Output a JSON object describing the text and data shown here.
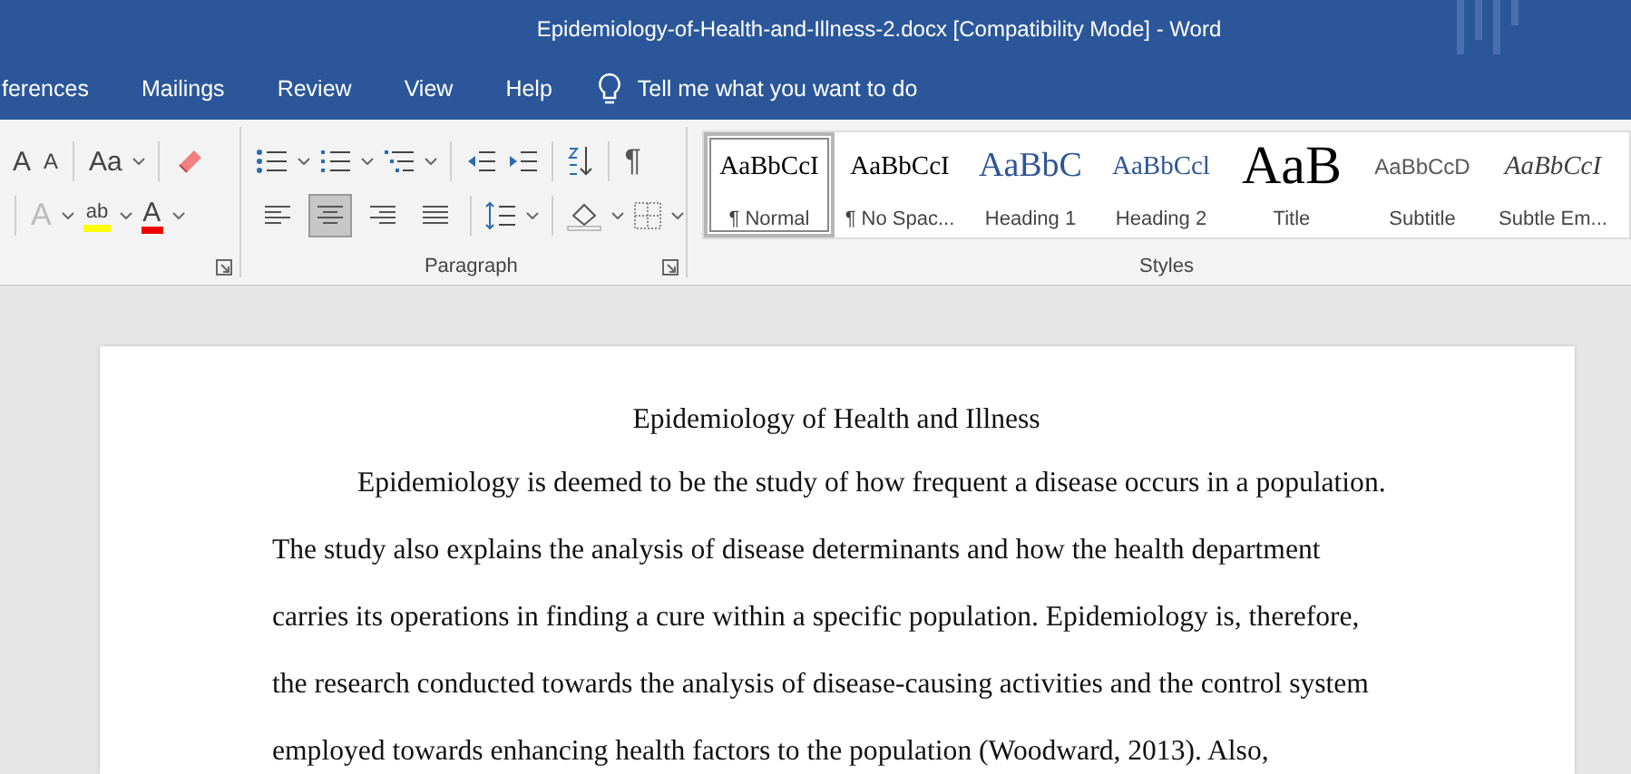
{
  "window": {
    "title": "Epidemiology-of-Health-and-Illness-2.docx [Compatibility Mode]  -  Word"
  },
  "ribbon_tabs": [
    {
      "label": "ferences",
      "selected": false
    },
    {
      "label": "Mailings",
      "selected": false
    },
    {
      "label": "Review",
      "selected": false
    },
    {
      "label": "View",
      "selected": false
    },
    {
      "label": "Help",
      "selected": false
    }
  ],
  "tell_me": {
    "placeholder": "Tell me what you want to do"
  },
  "font_group": {
    "grow": "A",
    "shrink": "A",
    "change_case": "Aa",
    "text_effects": "A",
    "highlight": "ab",
    "font_color": "A"
  },
  "paragraph_group": {
    "label": "Paragraph",
    "show_marks": "¶",
    "alignments": [
      {
        "kind": "left",
        "selected": false
      },
      {
        "kind": "center",
        "selected": true
      },
      {
        "kind": "right",
        "selected": false
      },
      {
        "kind": "justify",
        "selected": false
      }
    ]
  },
  "styles_group": {
    "label": "Styles",
    "styles": [
      {
        "kind": "normal",
        "preview": "AaBbCcI",
        "name": "¶ Normal",
        "selected": true
      },
      {
        "kind": "nospacing",
        "preview": "AaBbCcI",
        "name": "¶ No Spac...",
        "selected": false
      },
      {
        "kind": "heading1",
        "preview": "AaBbC",
        "name": "Heading 1",
        "selected": false
      },
      {
        "kind": "heading2",
        "preview": "AaBbCcl",
        "name": "Heading 2",
        "selected": false
      },
      {
        "kind": "title",
        "preview": "AaB",
        "name": "Title",
        "selected": false
      },
      {
        "kind": "subtitle",
        "preview": "AaBbCcD",
        "name": "Subtitle",
        "selected": false
      },
      {
        "kind": "subtle",
        "preview": "AaBbCcI",
        "name": "Subtle Em...",
        "selected": false
      }
    ]
  },
  "document": {
    "title": "Epidemiology of Health and Illness",
    "paragraph": "Epidemiology is deemed to be the study of how frequent a disease occurs in a population. The study also explains the analysis of disease determinants and how the health department carries its operations in finding a cure within a specific population. Epidemiology is, therefore, the research conducted towards the analysis of disease-causing activities and the control system employed towards enhancing health factors to the population (Woodward, 2013). Also,"
  }
}
